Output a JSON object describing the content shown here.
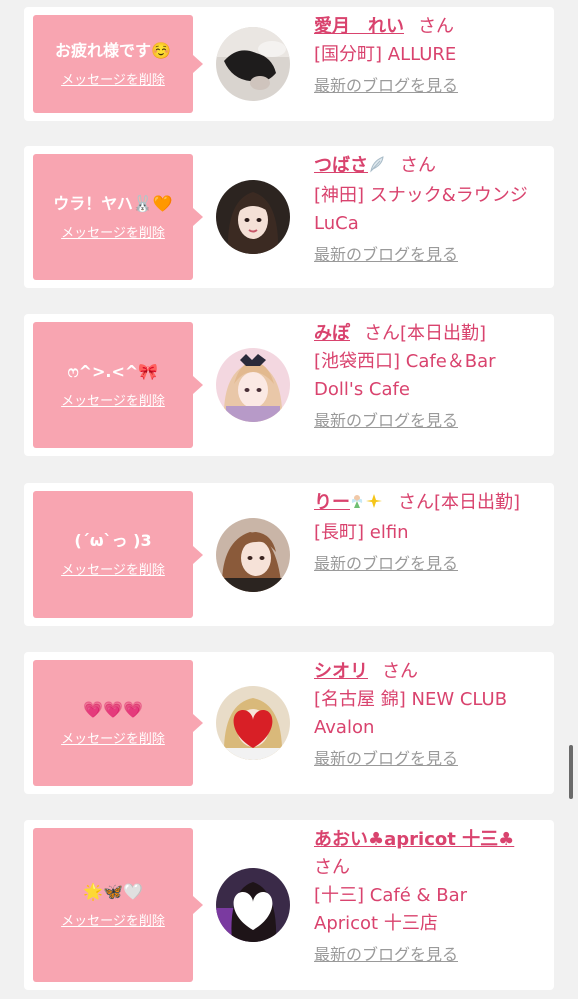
{
  "delete_label": "メッセージを削除",
  "blog_label": "最新のブログを見る",
  "san": "さん",
  "cards": [
    {
      "message": "お疲れ様です☺️",
      "name": "愛月　れい",
      "name_icon": "",
      "san": "さん",
      "status": "",
      "shop": "[国分町] ALLURE"
    },
    {
      "message": "ウラ！ヤハ🐰🧡",
      "name": "つばさ",
      "name_icon": "feather-icon",
      "san": "さん",
      "status": "",
      "shop": "[神田] スナック&ラウンジLuCa"
    },
    {
      "message": "ෆ^>.<^🎀",
      "name": "みぽ",
      "name_icon": "",
      "san": "さん",
      "status": "[本日出勤]",
      "shop": "[池袋西口] Cafe＆Bar Doll's Cafe"
    },
    {
      "message": "(´ω`っ )3",
      "name": "りー",
      "name_icon": "fairy-sparkles-icon",
      "san": "さん",
      "status": "[本日出勤]",
      "shop": "[長町] elfin"
    },
    {
      "message": "💗💗💗",
      "name": "シオリ",
      "name_icon": "",
      "san": "さん",
      "status": "",
      "shop": "[名古屋 錦] NEW CLUB Avalon"
    },
    {
      "message": "🌟🦋🤍",
      "name": "あおい♣apricot 十三♣",
      "name_icon": "",
      "san": "さん",
      "status": "",
      "shop": "[十三] Café & Bar Apricot 十三店"
    }
  ],
  "colors": {
    "bubble": "#f8a5b1",
    "name": "#d9436e",
    "blog_link": "#9a9a9a",
    "background": "#f1f1f1"
  }
}
